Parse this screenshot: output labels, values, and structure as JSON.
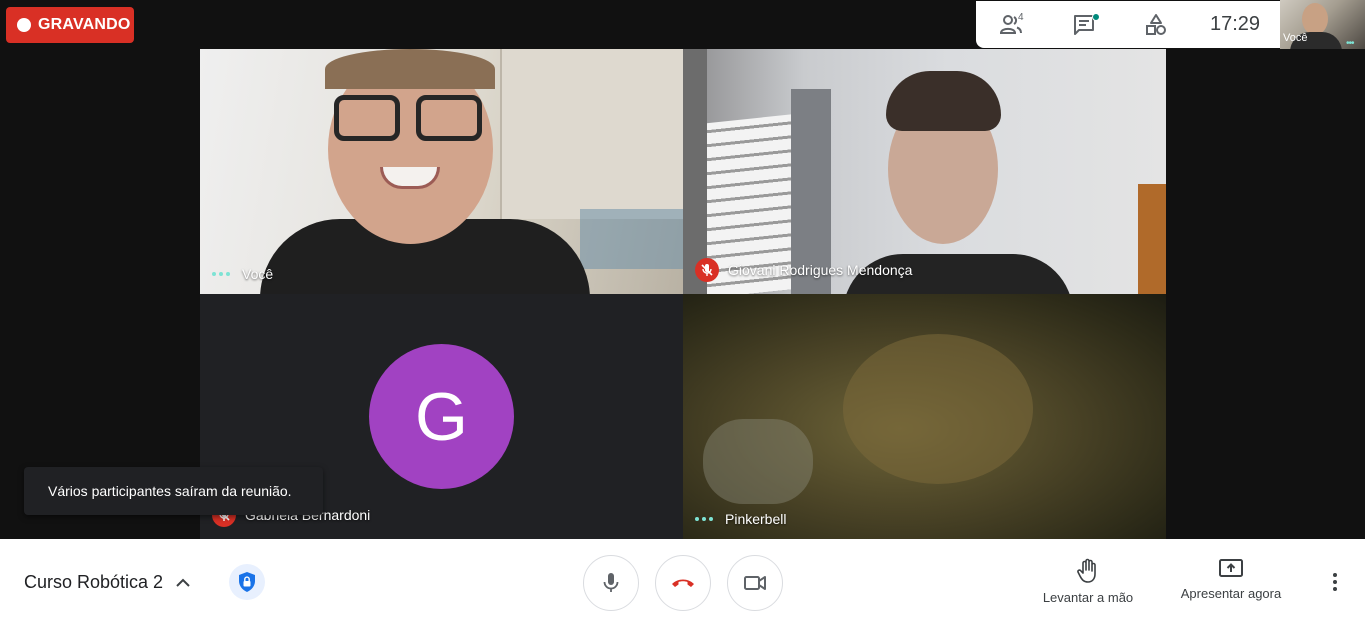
{
  "recording": {
    "label": "GRAVANDO",
    "color": "#d93025"
  },
  "top_panel": {
    "participants_icon": "people-icon",
    "participants_count": "4",
    "chat_icon": "chat-icon",
    "activities_icon": "shapes-icon",
    "clock": "17:29"
  },
  "self_preview": {
    "label": "Você"
  },
  "tiles": [
    {
      "name": "Você",
      "state": "speaking"
    },
    {
      "name": "Giovani Rodrigues Mendonça",
      "state": "muted"
    },
    {
      "name": "Gabriela Bernardoni",
      "state": "muted",
      "avatar_letter": "G",
      "avatar_color": "#a142c2"
    },
    {
      "name": "Pinkerbell",
      "state": "speaking"
    }
  ],
  "toast": {
    "text": "Vários participantes saíram da reunião."
  },
  "bottom_bar": {
    "meeting_title": "Curso Robótica 2",
    "raise_hand_label": "Levantar a mão",
    "present_label": "Apresentar agora",
    "end_call_color": "#d93025"
  }
}
